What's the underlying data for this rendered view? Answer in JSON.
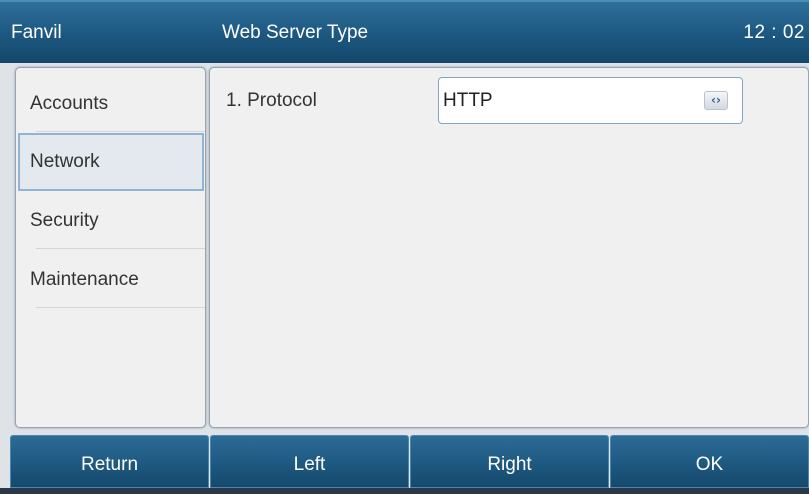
{
  "header": {
    "brand": "Fanvil",
    "title": "Web Server Type",
    "clock": "12 : 02"
  },
  "sidebar": {
    "items": [
      {
        "label": "Accounts",
        "selected": false
      },
      {
        "label": "Network",
        "selected": true
      },
      {
        "label": "Security",
        "selected": false
      },
      {
        "label": "Maintenance",
        "selected": false
      }
    ]
  },
  "main": {
    "fields": [
      {
        "label": "1. Protocol",
        "value": "HTTP",
        "control_icon": "left-right-arrows-icon"
      }
    ]
  },
  "softkeys": [
    {
      "label": "Return"
    },
    {
      "label": "Left"
    },
    {
      "label": "Right"
    },
    {
      "label": "OK"
    }
  ],
  "colors": {
    "header_blue": "#1c5780",
    "selected_border": "#90b4d4",
    "panel_bg": "#f0f0f0"
  }
}
